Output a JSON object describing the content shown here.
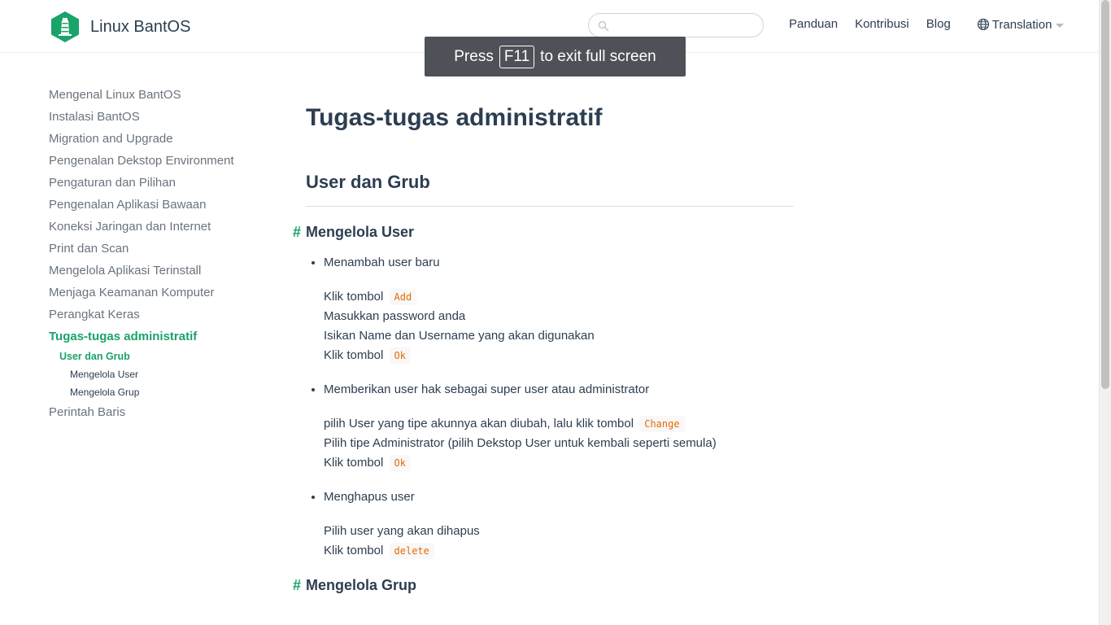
{
  "brand": {
    "title": "Linux BantOS"
  },
  "search": {
    "placeholder": "",
    "value": ""
  },
  "nav": {
    "links": [
      "Panduan",
      "Kontribusi",
      "Blog"
    ],
    "translation": "Translation"
  },
  "fullscreen_toast": {
    "prefix": "Press",
    "key": "F11",
    "suffix": "to exit full screen"
  },
  "sidebar": {
    "items": [
      "Mengenal Linux BantOS",
      "Instalasi BantOS",
      "Migration and Upgrade",
      "Pengenalan Dekstop Environment",
      "Pengaturan dan Pilihan",
      "Pengenalan Aplikasi Bawaan",
      "Koneksi Jaringan dan Internet",
      "Print dan Scan",
      "Mengelola Aplikasi Terinstall",
      "Menjaga Keamanan Komputer",
      "Perangkat Keras",
      "Tugas-tugas administratif"
    ],
    "sub_item": "User dan Grub",
    "subsub_items": [
      "Mengelola User",
      "Mengelola Grup"
    ],
    "last_item": "Perintah Baris"
  },
  "content": {
    "title": "Tugas-tugas administratif",
    "section": "User dan Grub",
    "anchor": "#",
    "h3_user": "Mengelola User",
    "steps": [
      {
        "title": "Menambah user baru",
        "l1_text": "Klik tombol",
        "l1_code": "Add",
        "l2_text": "Masukkan password anda",
        "l3_text": "Isikan Name dan Username yang akan digunakan",
        "l4_text": "Klik tombol",
        "l4_code": "Ok"
      },
      {
        "title": "Memberikan user hak sebagai super user atau administrator",
        "l1_text": "pilih User yang tipe akunnya akan diubah, lalu klik tombol",
        "l1_code": "Change",
        "l2_text": "Pilih tipe Administrator (pilih Dekstop User untuk kembali seperti semula)",
        "l3_text": "Klik tombol",
        "l3_code": "Ok"
      },
      {
        "title": "Menghapus user",
        "l1_text": "Pilih user yang akan dihapus",
        "l2_text": "Klik tombol",
        "l2_code": "delete"
      }
    ],
    "h3_grup": "Mengelola Grup"
  },
  "colors": {
    "accent": "#1aa36a",
    "text": "#2c3e50",
    "code": "#e96900"
  }
}
